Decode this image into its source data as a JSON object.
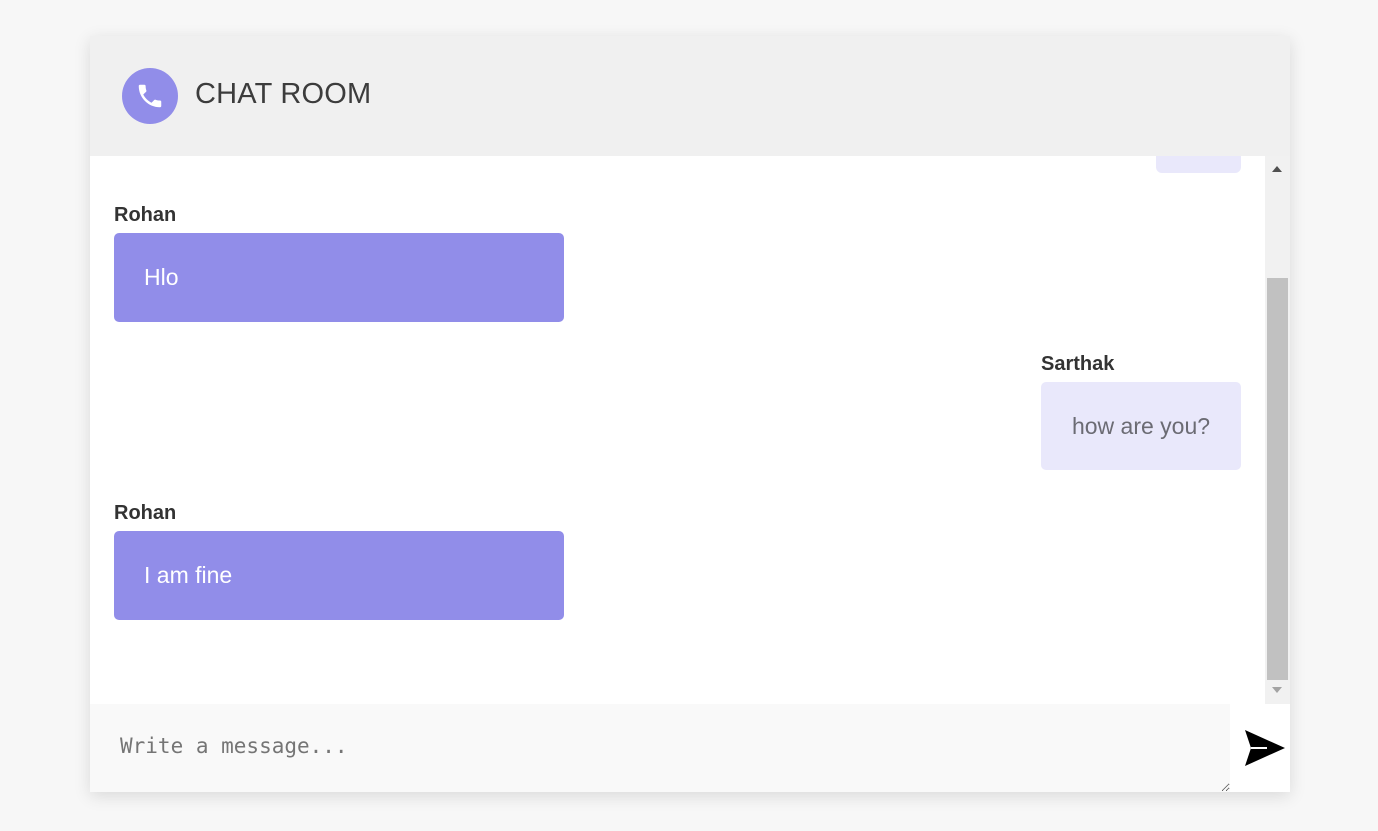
{
  "header": {
    "title": "CHAT ROOM",
    "icon": "phone-icon",
    "icon_color": "#918de9"
  },
  "messages": [
    {
      "sender": "Rohan",
      "text": "Hlo",
      "direction": "incoming"
    },
    {
      "sender": "Sarthak",
      "text": "how are you?",
      "direction": "outgoing"
    },
    {
      "sender": "Rohan",
      "text": "I am fine",
      "direction": "incoming"
    }
  ],
  "composer": {
    "placeholder": "Write a message...",
    "value": "",
    "send_icon": "send-icon"
  },
  "colors": {
    "incoming_bubble": "#918de9",
    "outgoing_bubble": "#e9e8fb",
    "header_background": "#f0f0f0"
  }
}
